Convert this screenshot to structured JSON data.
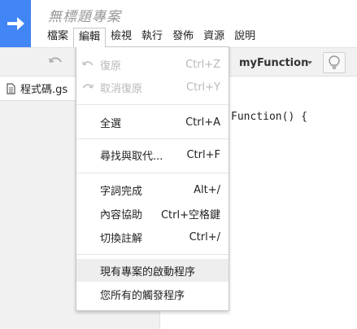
{
  "header": {
    "title": "無標題專案",
    "menus": [
      "檔案",
      "編輯",
      "檢視",
      "執行",
      "發佈",
      "資源",
      "說明"
    ]
  },
  "toolbar": {
    "function_name": "myFunction"
  },
  "sidebar": {
    "file_name": "程式碼.gs"
  },
  "editor": {
    "visible_code": "Function() {"
  },
  "edit_menu": {
    "items": [
      {
        "label": "復原",
        "shortcut": "Ctrl+Z"
      },
      {
        "label": "取消復原",
        "shortcut": "Ctrl+Y"
      },
      {
        "label": "全選",
        "shortcut": "Ctrl+A"
      },
      {
        "label": "尋找與取代...",
        "shortcut": "Ctrl+F"
      },
      {
        "label": "字詞完成",
        "shortcut": "Alt+/"
      },
      {
        "label": "內容協助",
        "shortcut": "Ctrl+空格鍵"
      },
      {
        "label": "切換註解",
        "shortcut": "Ctrl+/"
      },
      {
        "label": "現有專案的啟動程序",
        "shortcut": ""
      },
      {
        "label": "您所有的觸發程序",
        "shortcut": ""
      }
    ]
  },
  "colors": {
    "brand": "#4285f4",
    "disabled_text": "#b8b8b8",
    "hover_bg": "#eeeeee"
  }
}
